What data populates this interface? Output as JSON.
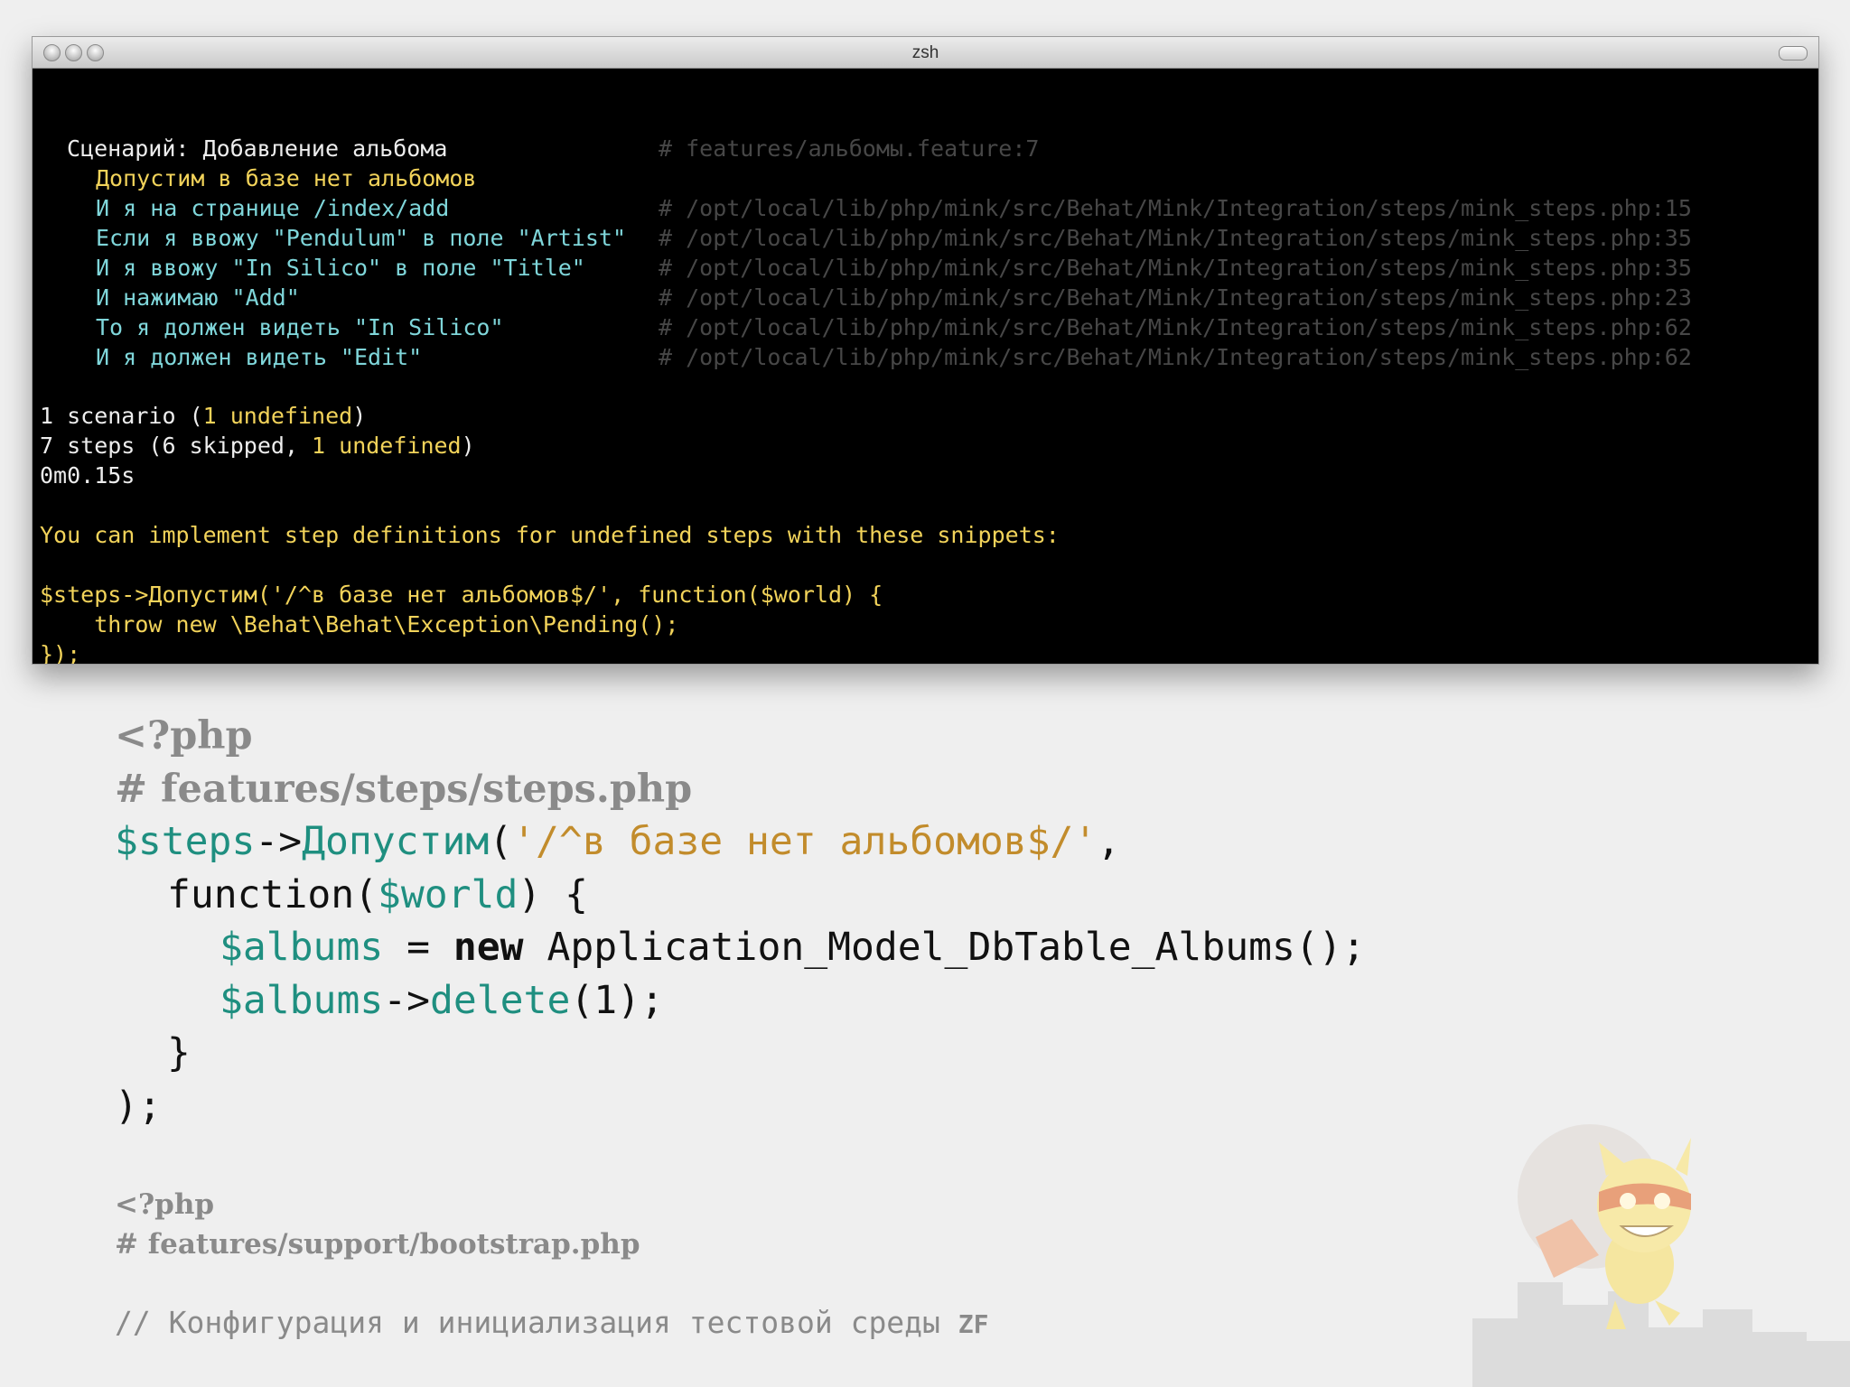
{
  "window": {
    "title": "zsh"
  },
  "terminal": {
    "scenario_line": "Сценарий: Добавление альбома",
    "scenario_path": "# features/альбомы.feature:7",
    "steps": [
      {
        "text": "Допустим в базе нет альбомов",
        "path": ""
      },
      {
        "text": "И я на странице /index/add",
        "path": "# /opt/local/lib/php/mink/src/Behat/Mink/Integration/steps/mink_steps.php:15"
      },
      {
        "text": "Если я ввожу \"Pendulum\" в поле \"Artist\"",
        "path": "# /opt/local/lib/php/mink/src/Behat/Mink/Integration/steps/mink_steps.php:35"
      },
      {
        "text": "И я ввожу \"In Silico\" в поле \"Title\"",
        "path": "# /opt/local/lib/php/mink/src/Behat/Mink/Integration/steps/mink_steps.php:35"
      },
      {
        "text": "И нажимаю \"Add\"",
        "path": "# /opt/local/lib/php/mink/src/Behat/Mink/Integration/steps/mink_steps.php:23"
      },
      {
        "text": "То я должен видеть \"In Silico\"",
        "path": "# /opt/local/lib/php/mink/src/Behat/Mink/Integration/steps/mink_steps.php:62"
      },
      {
        "text": "И я должен видеть \"Edit\"",
        "path": "# /opt/local/lib/php/mink/src/Behat/Mink/Integration/steps/mink_steps.php:62"
      }
    ],
    "summary": {
      "scenario_prefix": "1 scenario (",
      "scenario_undefined": "1 undefined",
      "scenario_suffix": ")",
      "steps_prefix": "7 steps (",
      "steps_skipped": "6 skipped",
      "steps_sep": ", ",
      "steps_undefined": "1 undefined",
      "steps_suffix": ")",
      "time": "0m0.15s"
    },
    "hint": "You can implement step definitions for undefined steps with these snippets:",
    "snippet": [
      "$steps->Допустим('/^в базе нет альбомов$/', function($world) {",
      "    throw new \\Behat\\Behat\\Exception\\Pending();",
      "});"
    ]
  },
  "code_main": {
    "php_open": "<?php",
    "file_comment": "# features/steps/steps.php",
    "steps_var": "$steps",
    "arrow1": "->",
    "method": "Допустим",
    "paren_open": "(",
    "regex": "'/^в базе нет альбомов$/'",
    "comma": ",",
    "function_kw": "function(",
    "world_var": "$world",
    "function_end": ") {",
    "albums_var1": "$albums",
    "assign": " = ",
    "new_kw": "new",
    "class_call": " Application_Model_DbTable_Albums();",
    "albums_var2": "$albums",
    "arrow2": "->",
    "delete_method": "delete",
    "delete_args": "(1);",
    "close_brace": "}",
    "close_paren": ");"
  },
  "code_second": {
    "php_open": "<?php",
    "file_comment": "# features/support/bootstrap.php",
    "comment_text": "// Конфигурация и инициализация тестовой среды ",
    "comment_zf": "ZF"
  },
  "colors": {
    "terminal_bg": "#000000",
    "yellow": "#f2d35a",
    "cyan": "#7fd6da",
    "teal": "#1f8f80",
    "string": "#c28c2c",
    "slide_bg": "#efefef"
  },
  "mascot": "ninja-cat-illustration"
}
